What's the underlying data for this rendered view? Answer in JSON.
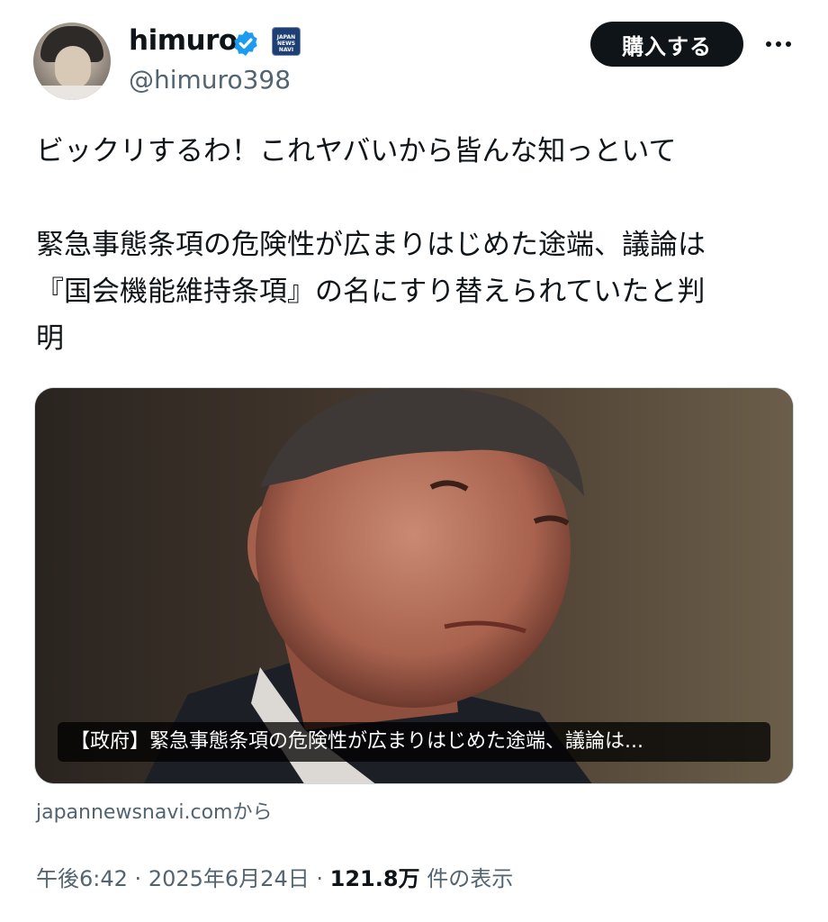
{
  "user": {
    "name": "himuro",
    "handle": "@himuro398",
    "badge_text": "JAPAN NEWS NAVI",
    "avatar_icon": "profile-photo"
  },
  "actions": {
    "buy_label": "購入する",
    "more_icon": "more-horizontal-icon"
  },
  "tweet": {
    "line1": "ビックリするわ！これヤバいから皆んな知っといて",
    "line2": "緊急事態条項の危険性が広まりはじめた途端、議論は",
    "line3": "『国会機能維持条項』の名にすり替えられていたと判",
    "line4": "明"
  },
  "card": {
    "title": "【政府】緊急事態条項の危険性が広まりはじめた途端、議論は...",
    "source": "japannewsnavi.comから"
  },
  "meta": {
    "time": "午後6:42",
    "separator": "·",
    "date": "2025年6月24日",
    "views": "121.8万",
    "views_label": "件の表示"
  },
  "colors": {
    "text": "#0f1419",
    "secondary": "#536471",
    "verified": "#1d9bf0",
    "button_bg": "#0f1419"
  }
}
